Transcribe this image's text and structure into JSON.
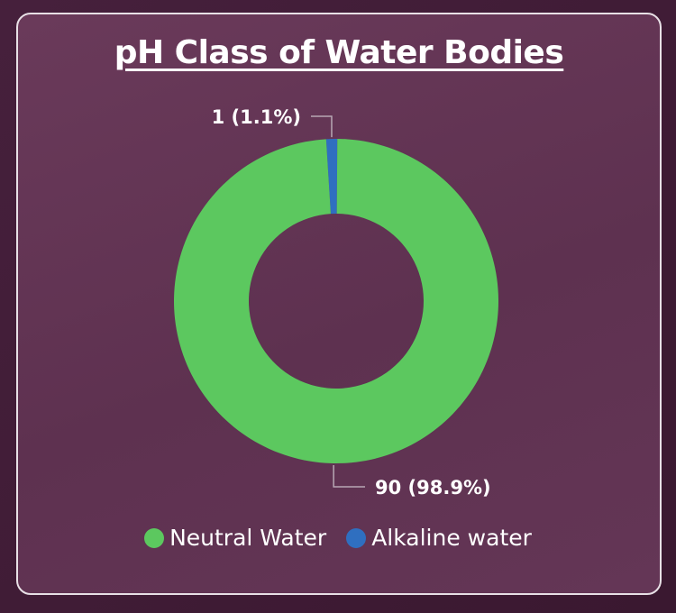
{
  "chart_data": {
    "type": "pie",
    "variant": "donut",
    "title": "pH Class of Water Bodies",
    "slices": [
      {
        "name": "Neutral Water",
        "value": 90,
        "percent": 98.9,
        "label": "90 (98.9%)",
        "color": "#5cc85f"
      },
      {
        "name": "Alkaline water",
        "value": 1,
        "percent": 1.1,
        "label": "1 (1.1%)",
        "color": "#2f6fc0"
      }
    ],
    "legend_placement": "bottom-center"
  },
  "colors": {
    "background": "#5e3150",
    "label_text": "#ffffff",
    "leader_line": "#b8a8b4"
  }
}
